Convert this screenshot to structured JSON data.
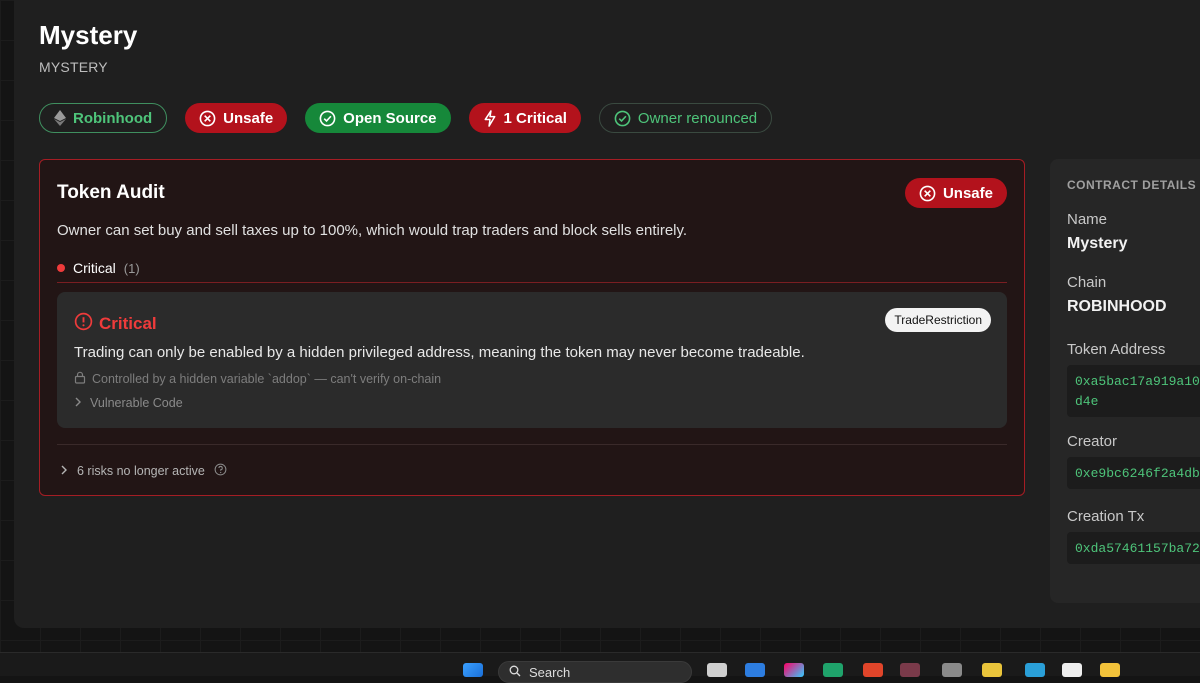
{
  "token": {
    "name": "Mystery",
    "symbol": "MYSTERY"
  },
  "badges": [
    {
      "label": "Robinhood",
      "icon": "ethereum-icon"
    },
    {
      "label": "Unsafe",
      "icon": "x-circle-icon"
    },
    {
      "label": "Open Source",
      "icon": "check-circle-icon"
    },
    {
      "label": "1 Critical",
      "icon": "lightning-icon"
    },
    {
      "label": "Owner renounced",
      "icon": "check-circle-icon"
    }
  ],
  "audit": {
    "title": "Token Audit",
    "status": "Unsafe",
    "description": "Owner can set buy and sell taxes up to 100%, which would trap traders and block sells entirely.",
    "severity_label": "Critical",
    "severity_count": "(1)",
    "finding": {
      "severity": "Critical",
      "tag": "TradeRestriction",
      "text": "Trading can only be enabled by a hidden privileged address, meaning the token may never become tradeable.",
      "note": "Controlled by a hidden variable `addop` — can't verify on-chain",
      "code_toggle": "Vulnerable Code"
    },
    "inactive_risks": "6 risks no longer active"
  },
  "contract_details": {
    "heading": "CONTRACT DETAILS",
    "name_label": "Name",
    "name_value": "Mystery",
    "chain_label": "Chain",
    "chain_value": "ROBINHOOD",
    "token_address_label": "Token Address",
    "token_address_value": "0xa5bac17a919a10\nd4e",
    "creator_label": "Creator",
    "creator_value": "0xe9bc6246f2a4db",
    "creation_tx_label": "Creation Tx",
    "creation_tx_value": "0xda57461157ba72"
  },
  "taskbar": {
    "search_label": "Search"
  },
  "colors": {
    "critical": "#ef3b3b",
    "safe": "#4ec47a",
    "danger_bg": "#b3121c",
    "success_bg": "#16883a"
  }
}
